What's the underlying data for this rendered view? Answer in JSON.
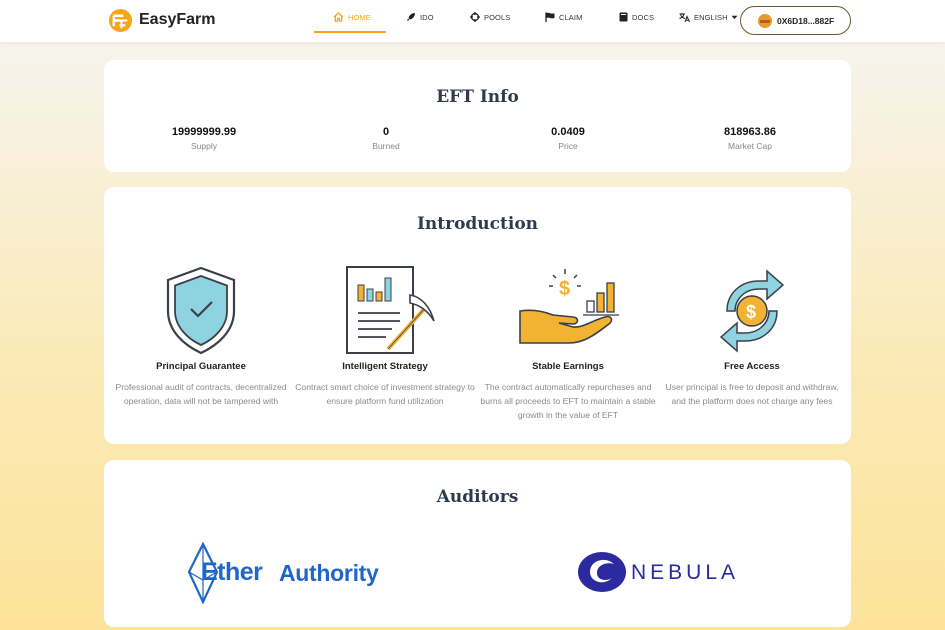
{
  "header": {
    "brand": "EasyFarm",
    "nav": [
      {
        "label": "HOME",
        "icon": "home-icon",
        "active": true
      },
      {
        "label": "IDO",
        "icon": "rocket-icon"
      },
      {
        "label": "POOLS",
        "icon": "crosshair-icon"
      },
      {
        "label": "CLAIM",
        "icon": "flag-icon"
      },
      {
        "label": "DOCS",
        "icon": "book-icon"
      }
    ],
    "language": "ENGLISH",
    "wallet": "0X6D18...882F"
  },
  "eft_info": {
    "title": "EFT Info",
    "stats": [
      {
        "value": "19999999.99",
        "label": "Supply"
      },
      {
        "value": "0",
        "label": "Burned"
      },
      {
        "value": "0.0409",
        "label": "Price"
      },
      {
        "value": "818963.86",
        "label": "Market Cap"
      }
    ]
  },
  "introduction": {
    "title": "Introduction",
    "features": [
      {
        "title": "Principal Guarantee",
        "desc": "Professional audit of contracts, decentralized operation, data will not be tampered with",
        "icon": "shield-check-icon"
      },
      {
        "title": "Intelligent Strategy",
        "desc": "Contract smart choice of investment strategy to ensure platform fund utilization",
        "icon": "report-pickaxe-icon"
      },
      {
        "title": "Stable Earnings",
        "desc": "The contract automatically repurchases and burns all proceeds to EFT to maintain a stable growth in the value of EFT",
        "icon": "hand-dollar-chart-icon"
      },
      {
        "title": "Free Access",
        "desc": "User principal is free to deposit and withdraw, and the platform does not charge any fees",
        "icon": "dollar-exchange-icon"
      }
    ]
  },
  "auditors": {
    "title": "Auditors",
    "items": [
      {
        "name_part1": "Ether",
        "name_part2": "Authority"
      },
      {
        "name": "NEBULA"
      }
    ]
  },
  "colors": {
    "accent": "#f5a516",
    "title": "#2e3a4e",
    "ether_authority_blue": "#1e66c8",
    "nebula_blue": "#2b2a9e"
  }
}
